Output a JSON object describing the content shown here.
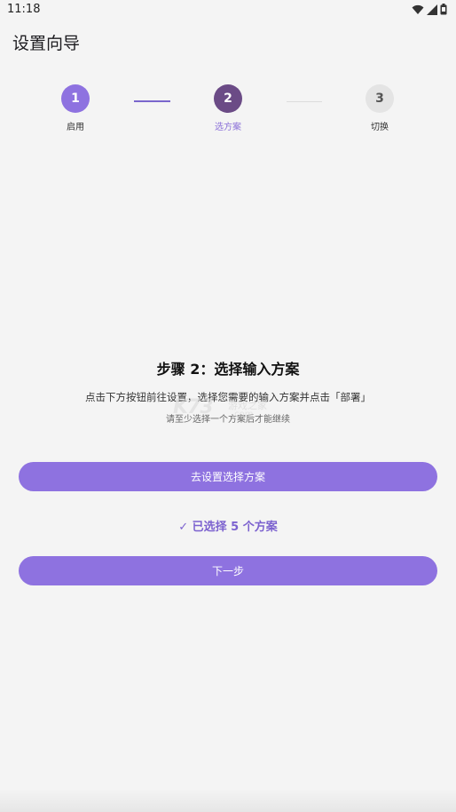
{
  "status_bar": {
    "time": "11:18",
    "icons": [
      "wifi-icon",
      "signal-icon",
      "battery-icon"
    ]
  },
  "header": {
    "title": "设置向导"
  },
  "stepper": {
    "current_step": 2,
    "steps": [
      {
        "number": "1",
        "label": "启用",
        "state": "completed"
      },
      {
        "number": "2",
        "label": "选方案",
        "state": "active"
      },
      {
        "number": "3",
        "label": "切换",
        "state": "pending"
      }
    ]
  },
  "content": {
    "heading": "步骤 2：选择输入方案",
    "description": "点击下方按钮前往设置，选择您需要的输入方案并点击「部署」",
    "hint": "请至少选择一个方案后才能继续"
  },
  "watermark": {
    "logo": "K73",
    "text": "游戏之家",
    "domain": ".com"
  },
  "actions": {
    "settings_button": "去设置选择方案",
    "selected_status": "✓ 已选择 5 个方案",
    "next_button": "下一步"
  },
  "colors": {
    "accent": "#8e72e0",
    "active_step": "#6b4b86",
    "pending_step": "#e4e4e4",
    "background": "#f4f4f4"
  }
}
